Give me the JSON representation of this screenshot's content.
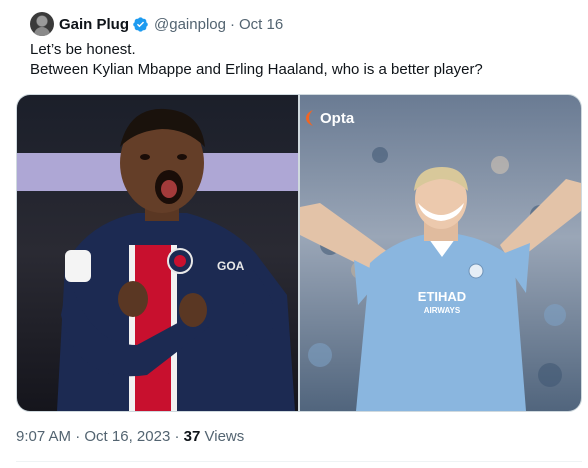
{
  "author": {
    "display_name": "Gain Plug",
    "handle": "@gainplog",
    "separator": "·",
    "date": "Oct 16",
    "verified": true,
    "avatar_icon": "avatar-icon",
    "verified_icon": "verified-badge-icon"
  },
  "tweet": {
    "line1": "Let’s be honest.",
    "line2": "Between Kylian Mbappe and Erling Haaland, who is a better player?"
  },
  "media": {
    "left_photo": "photo-mbappe",
    "right_photo": "photo-haaland",
    "right_watermark": "Opta",
    "jersey_text_left": "GOA",
    "jersey_text_right": "ETIHAD",
    "jersey_subtext_right": "AIRWAYS"
  },
  "meta": {
    "time": "9:07 AM",
    "separator": "·",
    "date": "Oct 16, 2023",
    "separator2": "·",
    "views_count": "37",
    "views_label": "Views"
  },
  "colors": {
    "text_primary": "#0f1419",
    "text_secondary": "#536471",
    "verified_blue": "#1d9bf0",
    "border": "#cfd9de",
    "psg_navy": "#1c2a52",
    "psg_red": "#c8102e",
    "city_blue": "#8ab6df"
  }
}
